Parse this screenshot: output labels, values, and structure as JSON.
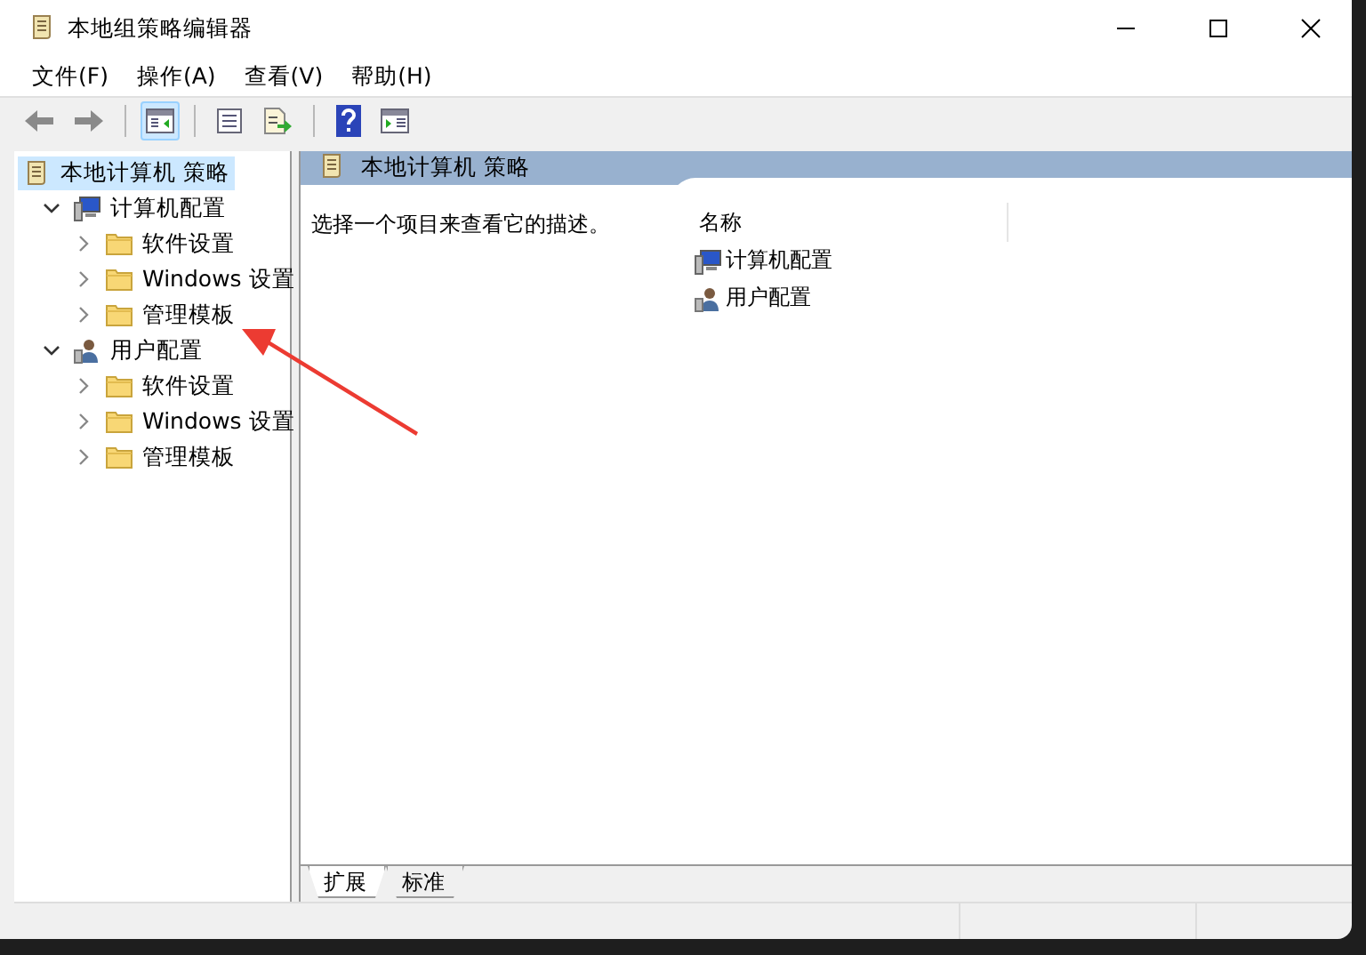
{
  "window": {
    "title": "本地组策略编辑器"
  },
  "menu": [
    {
      "label": "文件(F)"
    },
    {
      "label": "操作(A)"
    },
    {
      "label": "查看(V)"
    },
    {
      "label": "帮助(H)"
    }
  ],
  "toolbar": [
    [
      {
        "kind": "back",
        "pressed": false
      },
      {
        "kind": "forward",
        "pressed": false
      }
    ],
    [
      {
        "kind": "tree-toggle",
        "pressed": true
      }
    ],
    [
      {
        "kind": "properties",
        "pressed": false
      },
      {
        "kind": "export",
        "pressed": false
      }
    ],
    [
      {
        "kind": "help",
        "pressed": false
      },
      {
        "kind": "action-pane",
        "pressed": false
      }
    ]
  ],
  "tree": [
    {
      "label": "本地计算机 策略",
      "kind": "policy",
      "selected": true,
      "children": [
        {
          "label": "计算机配置",
          "kind": "computer",
          "selected": false,
          "expanded": true,
          "children": [
            {
              "label": "软件设置",
              "kind": "folder",
              "selected": false,
              "expanded": false
            },
            {
              "label": "Windows 设置",
              "kind": "folder",
              "selected": false,
              "expanded": false
            },
            {
              "label": "管理模板",
              "kind": "folder",
              "selected": false,
              "expanded": false
            }
          ]
        },
        {
          "label": "用户配置",
          "kind": "user",
          "selected": false,
          "expanded": true,
          "children": [
            {
              "label": "软件设置",
              "kind": "folder",
              "selected": false,
              "expanded": false
            },
            {
              "label": "Windows 设置",
              "kind": "folder",
              "selected": false,
              "expanded": false
            },
            {
              "label": "管理模板",
              "kind": "folder",
              "selected": false,
              "expanded": false
            }
          ]
        }
      ]
    }
  ],
  "details": {
    "title": "本地计算机 策略",
    "description": "选择一个项目来查看它的描述。",
    "columns": [
      "名称"
    ],
    "items": [
      {
        "label": "计算机配置",
        "kind": "computer"
      },
      {
        "label": "用户配置",
        "kind": "user"
      }
    ]
  },
  "tabs": [
    {
      "label": "扩展",
      "selected": true
    },
    {
      "label": "标准",
      "selected": false
    }
  ]
}
